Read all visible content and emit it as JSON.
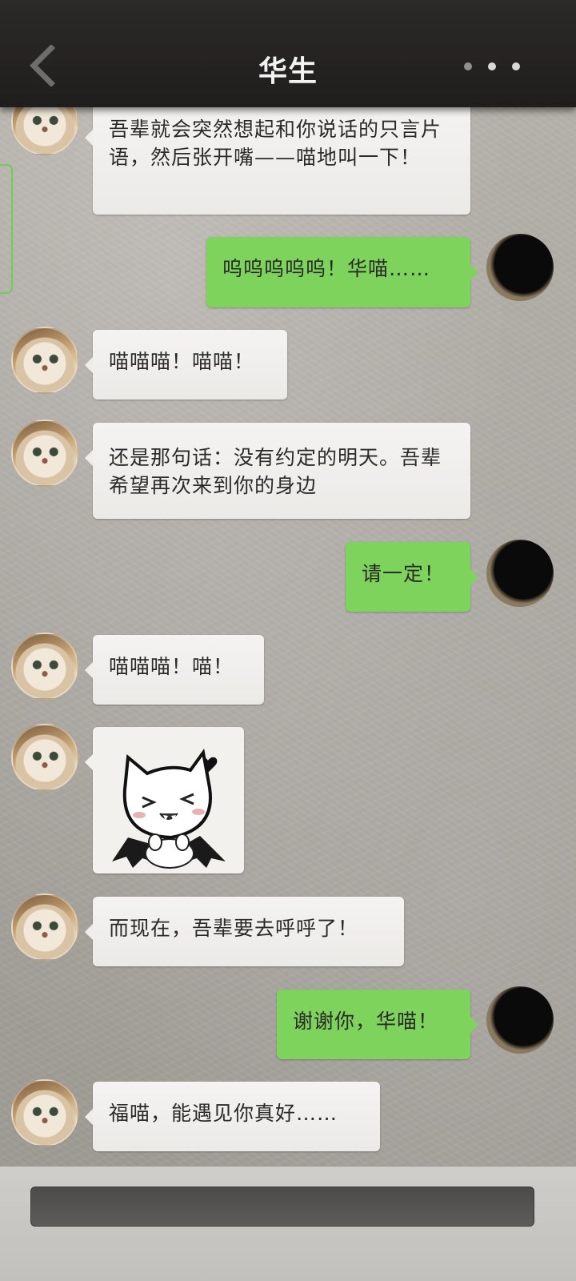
{
  "header": {
    "title": "华生"
  },
  "messages": [
    {
      "side": "left",
      "text": "吾辈就会突然想起和你说话的只言片语，然后张开嘴——喵地叫一下！"
    },
    {
      "side": "right",
      "text": "呜呜呜呜呜！华喵……"
    },
    {
      "side": "left",
      "text": "喵喵喵！喵喵！"
    },
    {
      "side": "left",
      "text": "还是那句话：没有约定的明天。吾辈希望再次来到你的身边"
    },
    {
      "side": "right",
      "text": "请一定！"
    },
    {
      "side": "left",
      "text": "喵喵喵！喵！"
    },
    {
      "side": "left",
      "type": "sticker",
      "sticker": "bat-cat-sticker"
    },
    {
      "side": "left",
      "text": "而现在，吾辈要去呼呼了！"
    },
    {
      "side": "right",
      "text": "谢谢你，华喵！"
    },
    {
      "side": "left",
      "text": "福喵，能遇见你真好……"
    }
  ],
  "colors": {
    "header_bg": "#222120",
    "sent_bubble": "#7dd35c",
    "received_bubble": "#efeeeb",
    "wallpaper": "#aaa6a0"
  },
  "icons": {
    "back": "chevron-left-icon",
    "more": "more-dots-icon"
  },
  "input": {
    "value": "",
    "placeholder": ""
  }
}
